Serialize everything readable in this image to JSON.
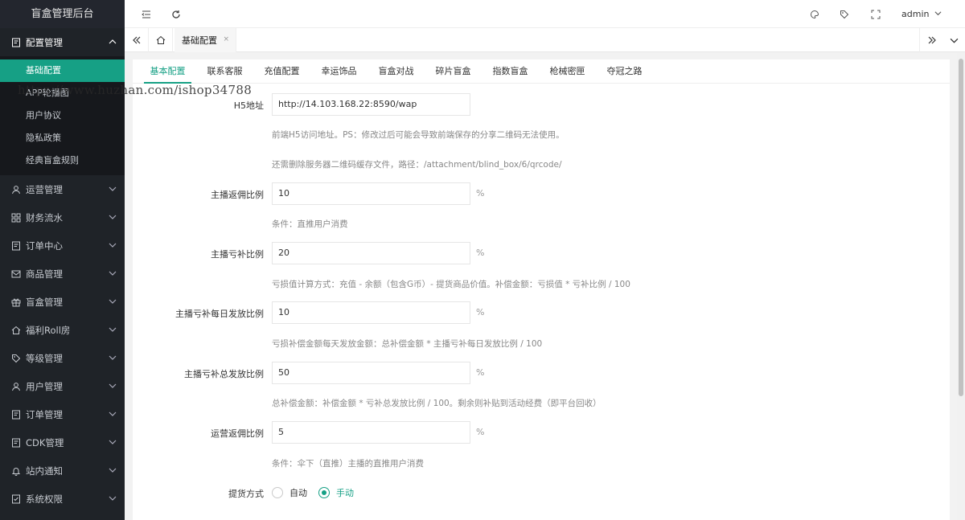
{
  "app": {
    "title": "盲盒管理后台"
  },
  "sidebar": {
    "open_group": {
      "label": "配置管理",
      "icon": "form-icon"
    },
    "sub_items": [
      "基础配置",
      "APP轮播图",
      "用户协议",
      "隐私政策",
      "经典盲盒规则"
    ],
    "groups": [
      {
        "label": "运营管理",
        "icon": "user-icon"
      },
      {
        "label": "财务流水",
        "icon": "grid-icon"
      },
      {
        "label": "订单中心",
        "icon": "list-icon"
      },
      {
        "label": "商品管理",
        "icon": "mail-icon"
      },
      {
        "label": "盲盒管理",
        "icon": "gift-icon"
      },
      {
        "label": "福利Roll房",
        "icon": "home-icon"
      },
      {
        "label": "等级管理",
        "icon": "tag-icon"
      },
      {
        "label": "用户管理",
        "icon": "user-icon"
      },
      {
        "label": "订单管理",
        "icon": "list-icon"
      },
      {
        "label": "CDK管理",
        "icon": "list-icon"
      },
      {
        "label": "站内通知",
        "icon": "bell-icon"
      },
      {
        "label": "系统权限",
        "icon": "form-icon"
      }
    ]
  },
  "header": {
    "user": "admin"
  },
  "tabs": {
    "active": "基础配置",
    "close": "×"
  },
  "content_tabs": [
    "基本配置",
    "联系客服",
    "充值配置",
    "幸运饰品",
    "盲盒对战",
    "碎片盲盒",
    "指数盲盒",
    "枪械密匣",
    "夺冠之路"
  ],
  "form": {
    "h5": {
      "label": "H5地址",
      "value": "http://14.103.168.22:8590/wap",
      "help1": "前端H5访问地址。PS：修改过后可能会导致前端保存的分享二维码无法使用。",
      "help2": "还需删除服务器二维码缓存文件，路径：/attachment/blind_box/6/qrcode/"
    },
    "anchor_rebate": {
      "label": "主播返佣比例",
      "value": "10",
      "unit": "%",
      "help": "条件：直推用户消费"
    },
    "anchor_loss": {
      "label": "主播亏补比例",
      "value": "20",
      "unit": "%",
      "help": "亏损值计算方式：充值 - 余额（包含G币）- 提货商品价值。补偿金额：亏损值 * 亏补比例 / 100"
    },
    "anchor_daily": {
      "label": "主播亏补每日发放比例",
      "value": "10",
      "unit": "%",
      "help": "亏损补偿金额每天发放金额：总补偿金额 * 主播亏补每日发放比例 / 100"
    },
    "anchor_total": {
      "label": "主播亏补总发放比例",
      "value": "50",
      "unit": "%",
      "help": "总补偿金额：补偿金额 * 亏补总发放比例 / 100。剩余则补贴到活动经费（即平台回收）"
    },
    "ops_rebate": {
      "label": "运营返佣比例",
      "value": "5",
      "unit": "%",
      "help": "条件：伞下（直推）主播的直推用户消费"
    },
    "pickup": {
      "label": "提货方式",
      "auto": "自动",
      "manual": "手动"
    }
  },
  "watermark": "https://www.huzhan.com/ishop34788",
  "colors": {
    "accent": "#16a085",
    "sidebar_bg": "#1f2328"
  }
}
